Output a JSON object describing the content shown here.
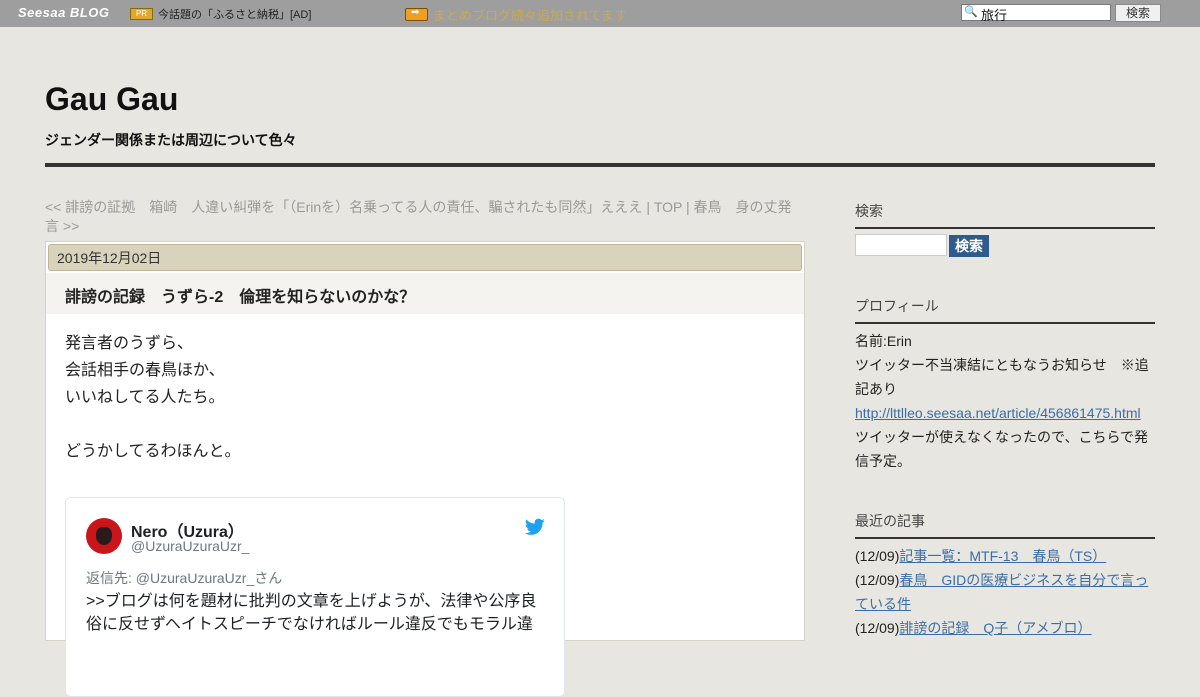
{
  "topbar": {
    "logo": "Seesaa BLOG",
    "pr_label": "PR",
    "pr_text": "今話題の「ふるさと納税」[AD]",
    "notice": "まとめブログ続々追加されてます",
    "search_value": "旅行",
    "search_button": "検索"
  },
  "header": {
    "title": "Gau Gau",
    "description": "ジェンダー関係または周辺について色々"
  },
  "nav": {
    "text": "<< 誹謗の証拠　箱崎　人違い糾弾を「（Erinを）名乗ってる人の責任、騙されたも同然」えええ | TOP | 春鳥　身の丈発言 >>"
  },
  "article": {
    "date": "2019年12月02日",
    "title": "誹謗の記録　うずら-2　倫理を知らないのかな？",
    "lines": [
      "発言者のうずら、",
      "会話相手の春鳥ほか、",
      "いいねしてる人たち。",
      "どうかしてるわほんと。"
    ]
  },
  "tweet": {
    "name": "Nero（Uzura）",
    "handle": "@UzuraUzuraUzr_",
    "reply": "返信先: @UzuraUzuraUzr_さん",
    "text": ">>ブログは何を題材に批判の文章を上げようが、法律や公序良俗に反せずヘイトスピーチでなければルール違反でもモラル違"
  },
  "sidebar": {
    "search_heading": "検索",
    "search_button": "検索",
    "profile_heading": "プロフィール",
    "profile_name": "名前:Erin",
    "profile_notice": "ツイッター不当凍結にともなうお知らせ　※追記あり",
    "profile_link": "http://lttlleo.seesaa.net/article/456861475.html",
    "profile_after": "ツイッターが使えなくなったので、こちらで発信予定。",
    "recent_heading": "最近の記事",
    "recent": [
      {
        "date": "(12/09)",
        "title": "記事一覧：MTF-13　春鳥（TS）"
      },
      {
        "date": "(12/09)",
        "title": "春鳥　GIDの医療ビジネスを自分で言っている件"
      },
      {
        "date": "(12/09)",
        "title": "誹謗の記録　Q子（アメブロ）"
      }
    ]
  }
}
